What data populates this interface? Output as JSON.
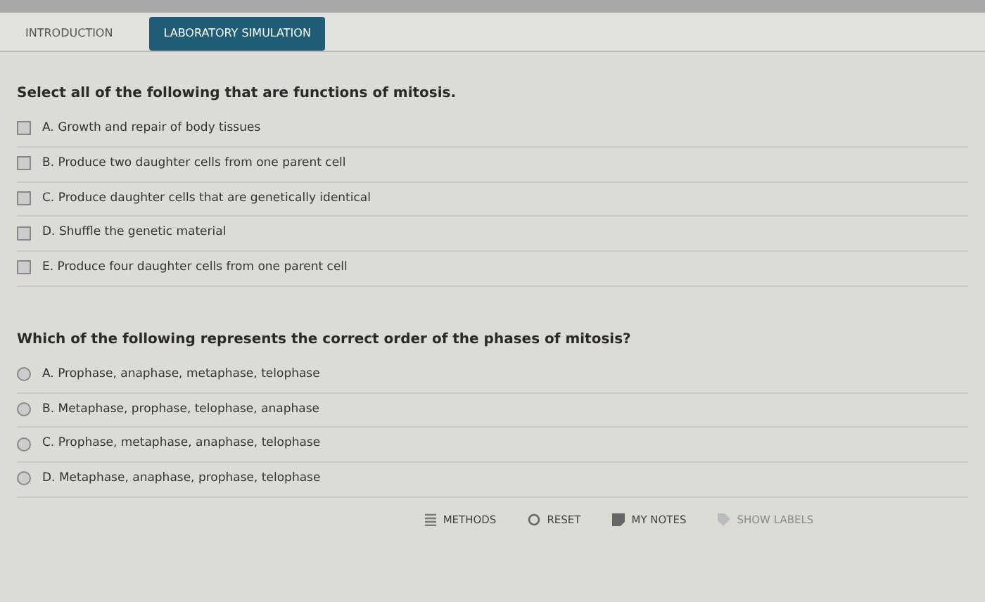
{
  "tabs": [
    {
      "label": "INTRODUCTION",
      "selected": false
    },
    {
      "label": "LABORATORY SIMULATION",
      "selected": true
    }
  ],
  "questions": [
    {
      "kind": "checkbox",
      "prompt": "Select all of the following that are functions of mitosis.",
      "options": [
        {
          "label": "A. Growth and repair of body tissues",
          "checked": false
        },
        {
          "label": "B. Produce two daughter cells from one parent cell",
          "checked": false
        },
        {
          "label": "C. Produce daughter cells that are genetically identical",
          "checked": false
        },
        {
          "label": "D. Shuffle the genetic material",
          "checked": false
        },
        {
          "label": "E. Produce four daughter cells from one parent cell",
          "checked": false
        }
      ]
    },
    {
      "kind": "radio",
      "prompt": "Which of the following represents the correct order of the phases of mitosis?",
      "options": [
        {
          "label": "A. Prophase, anaphase, metaphase, telophase",
          "checked": false
        },
        {
          "label": "B. Metaphase, prophase, telophase, anaphase",
          "checked": false
        },
        {
          "label": "C. Prophase, metaphase, anaphase, telophase",
          "checked": false
        },
        {
          "label": "D. Metaphase, anaphase, prophase, telophase",
          "checked": false
        }
      ]
    }
  ],
  "toolbar": [
    {
      "kind": "methods",
      "label": "METHODS",
      "disabled": false
    },
    {
      "kind": "reset",
      "label": "RESET",
      "disabled": false
    },
    {
      "kind": "notes",
      "label": "MY NOTES",
      "disabled": false
    },
    {
      "kind": "labels",
      "label": "SHOW LABELS",
      "disabled": true
    }
  ]
}
